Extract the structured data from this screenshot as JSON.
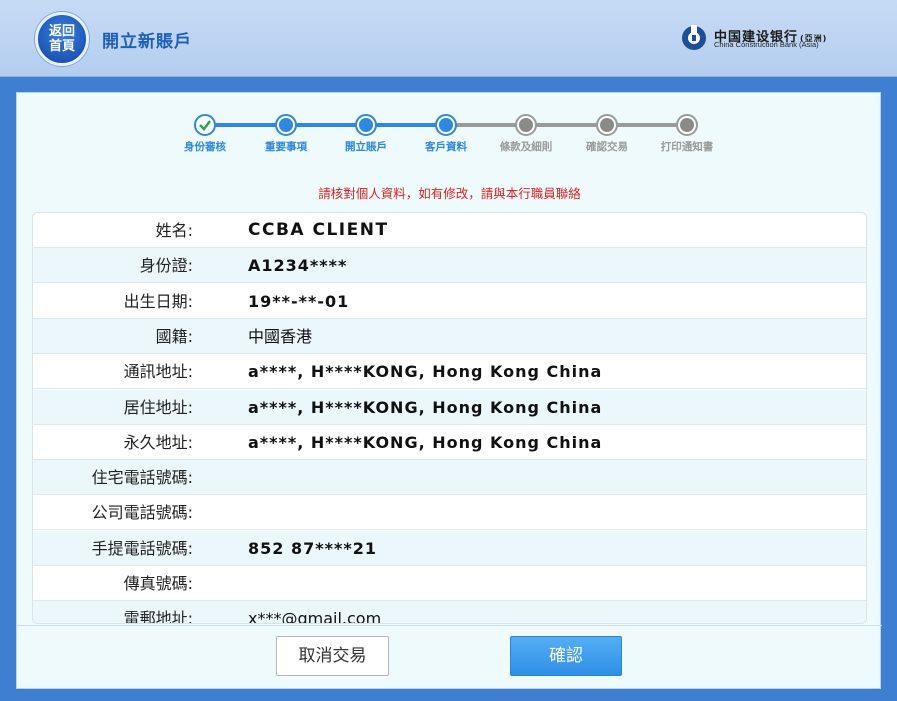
{
  "header": {
    "home_line1": "返回",
    "home_line2": "首頁",
    "title": "開立新賬戶",
    "bank_name_cn": "中国建设银行",
    "bank_name_cn_sub": "(亞洲)",
    "bank_name_en": "China Construction Bank (Asia)"
  },
  "stepper": {
    "steps": [
      {
        "label": "身份審核",
        "state": "done"
      },
      {
        "label": "重要事項",
        "state": "done"
      },
      {
        "label": "開立賬戶",
        "state": "done"
      },
      {
        "label": "客戶資料",
        "state": "current"
      },
      {
        "label": "條款及細則",
        "state": "todo"
      },
      {
        "label": "確認交易",
        "state": "todo"
      },
      {
        "label": "打印通知書",
        "state": "todo"
      }
    ]
  },
  "notice": "請核對個人資料，如有修改，請與本行職員聯絡",
  "info": {
    "rows": [
      {
        "label": "姓名:",
        "value": "CCBA CLIENT"
      },
      {
        "label": "身份證:",
        "value": "A1234****"
      },
      {
        "label": "出生日期:",
        "value": "19**-**-01"
      },
      {
        "label": "國籍:",
        "value": "中國香港"
      },
      {
        "label": "通訊地址:",
        "value": "a****, H****KONG, Hong Kong China"
      },
      {
        "label": "居住地址:",
        "value": "a****, H****KONG, Hong Kong China"
      },
      {
        "label": "永久地址:",
        "value": "a****, H****KONG, Hong Kong China"
      },
      {
        "label": "住宅電話號碼:",
        "value": ""
      },
      {
        "label": "公司電話號碼:",
        "value": ""
      },
      {
        "label": "手提電話號碼:",
        "value": "852 87****21"
      },
      {
        "label": "傳真號碼:",
        "value": ""
      },
      {
        "label": "電郵地址:",
        "value": "x***@gmail.com"
      }
    ]
  },
  "buttons": {
    "cancel": "取消交易",
    "confirm": "確認"
  },
  "colors": {
    "accent": "#2f88df",
    "notice": "#e02020",
    "todo": "#9a9a9a"
  }
}
